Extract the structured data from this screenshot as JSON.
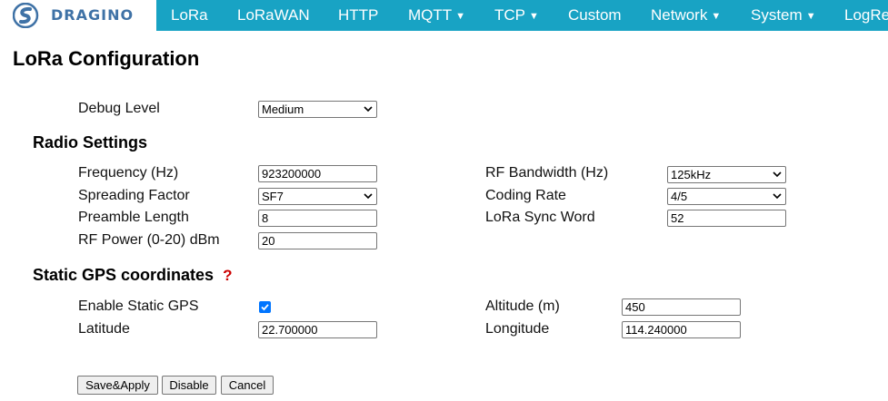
{
  "brand": {
    "name": "DRAGINO"
  },
  "nav": {
    "items": [
      {
        "label": "LoRa",
        "dropdown": false
      },
      {
        "label": "LoRaWAN",
        "dropdown": false
      },
      {
        "label": "HTTP",
        "dropdown": false
      },
      {
        "label": "MQTT",
        "dropdown": true
      },
      {
        "label": "TCP",
        "dropdown": true
      },
      {
        "label": "Custom",
        "dropdown": false
      },
      {
        "label": "Network",
        "dropdown": true
      },
      {
        "label": "System",
        "dropdown": true
      },
      {
        "label": "LogRe",
        "dropdown": false
      }
    ],
    "color": "#18a3c4"
  },
  "page": {
    "title": "LoRa Configuration"
  },
  "debug": {
    "label": "Debug Level",
    "value": "Medium"
  },
  "radio": {
    "title": "Radio Settings",
    "frequency": {
      "label": "Frequency (Hz)",
      "value": "923200000"
    },
    "spreading_factor": {
      "label": "Spreading Factor",
      "value": "SF7"
    },
    "preamble_length": {
      "label": "Preamble Length",
      "value": "8"
    },
    "rf_power": {
      "label": "RF Power (0-20) dBm",
      "value": "20"
    },
    "rf_bandwidth": {
      "label": "RF Bandwidth (Hz)",
      "value": "125kHz"
    },
    "coding_rate": {
      "label": "Coding Rate",
      "value": "4/5"
    },
    "sync_word": {
      "label": "LoRa Sync Word",
      "value": "52"
    }
  },
  "gps": {
    "title": "Static GPS coordinates",
    "help": "?",
    "enable": {
      "label": "Enable Static GPS",
      "checked": true
    },
    "latitude": {
      "label": "Latitude",
      "value": "22.700000"
    },
    "altitude": {
      "label": "Altitude (m)",
      "value": "450"
    },
    "longitude": {
      "label": "Longitude",
      "value": "114.240000"
    }
  },
  "buttons": {
    "save_apply": "Save&Apply",
    "disable": "Disable",
    "cancel": "Cancel"
  }
}
